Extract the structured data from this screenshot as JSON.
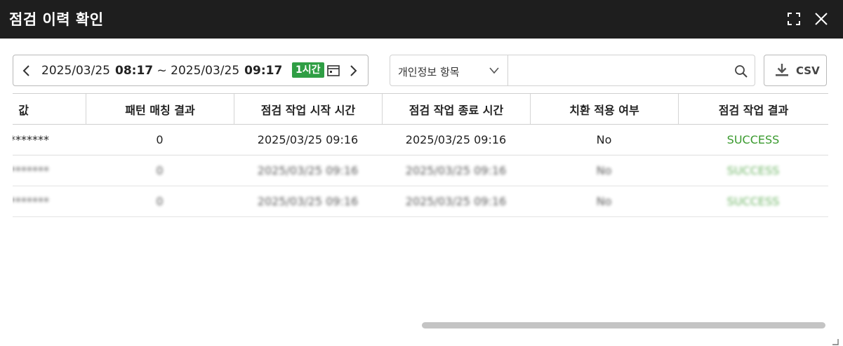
{
  "window": {
    "title": "점검 이력 확인",
    "expand_icon": "expand-icon",
    "close_icon": "close-icon"
  },
  "date_range": {
    "start_date": "2025/03/25",
    "start_time": "08:17",
    "separator": "~",
    "end_date": "2025/03/25",
    "end_time": "09:17",
    "badge": "1시간",
    "badge_color": "#2f9e44"
  },
  "search": {
    "select_value": "개인정보 항목",
    "input_value": "",
    "placeholder": ""
  },
  "csv_button": {
    "label": "CSV"
  },
  "table": {
    "headers": [
      "ㅏ 값",
      "패턴 매칭 결과",
      "점검 작업 시작 시간",
      "점검 작업 종료 시간",
      "치환 적용 여부",
      "점검 작업 결과"
    ],
    "rows": [
      [
        "********",
        "0",
        "2025/03/25 09:16",
        "2025/03/25 09:16",
        "No",
        "SUCCESS"
      ],
      [
        "********",
        "0",
        "2025/03/25 09:16",
        "2025/03/25 09:16",
        "No",
        "SUCCESS"
      ],
      [
        "********",
        "0",
        "2025/03/25 09:16",
        "2025/03/25 09:16",
        "No",
        "SUCCESS"
      ]
    ],
    "success_color": "#3a9a2e"
  }
}
